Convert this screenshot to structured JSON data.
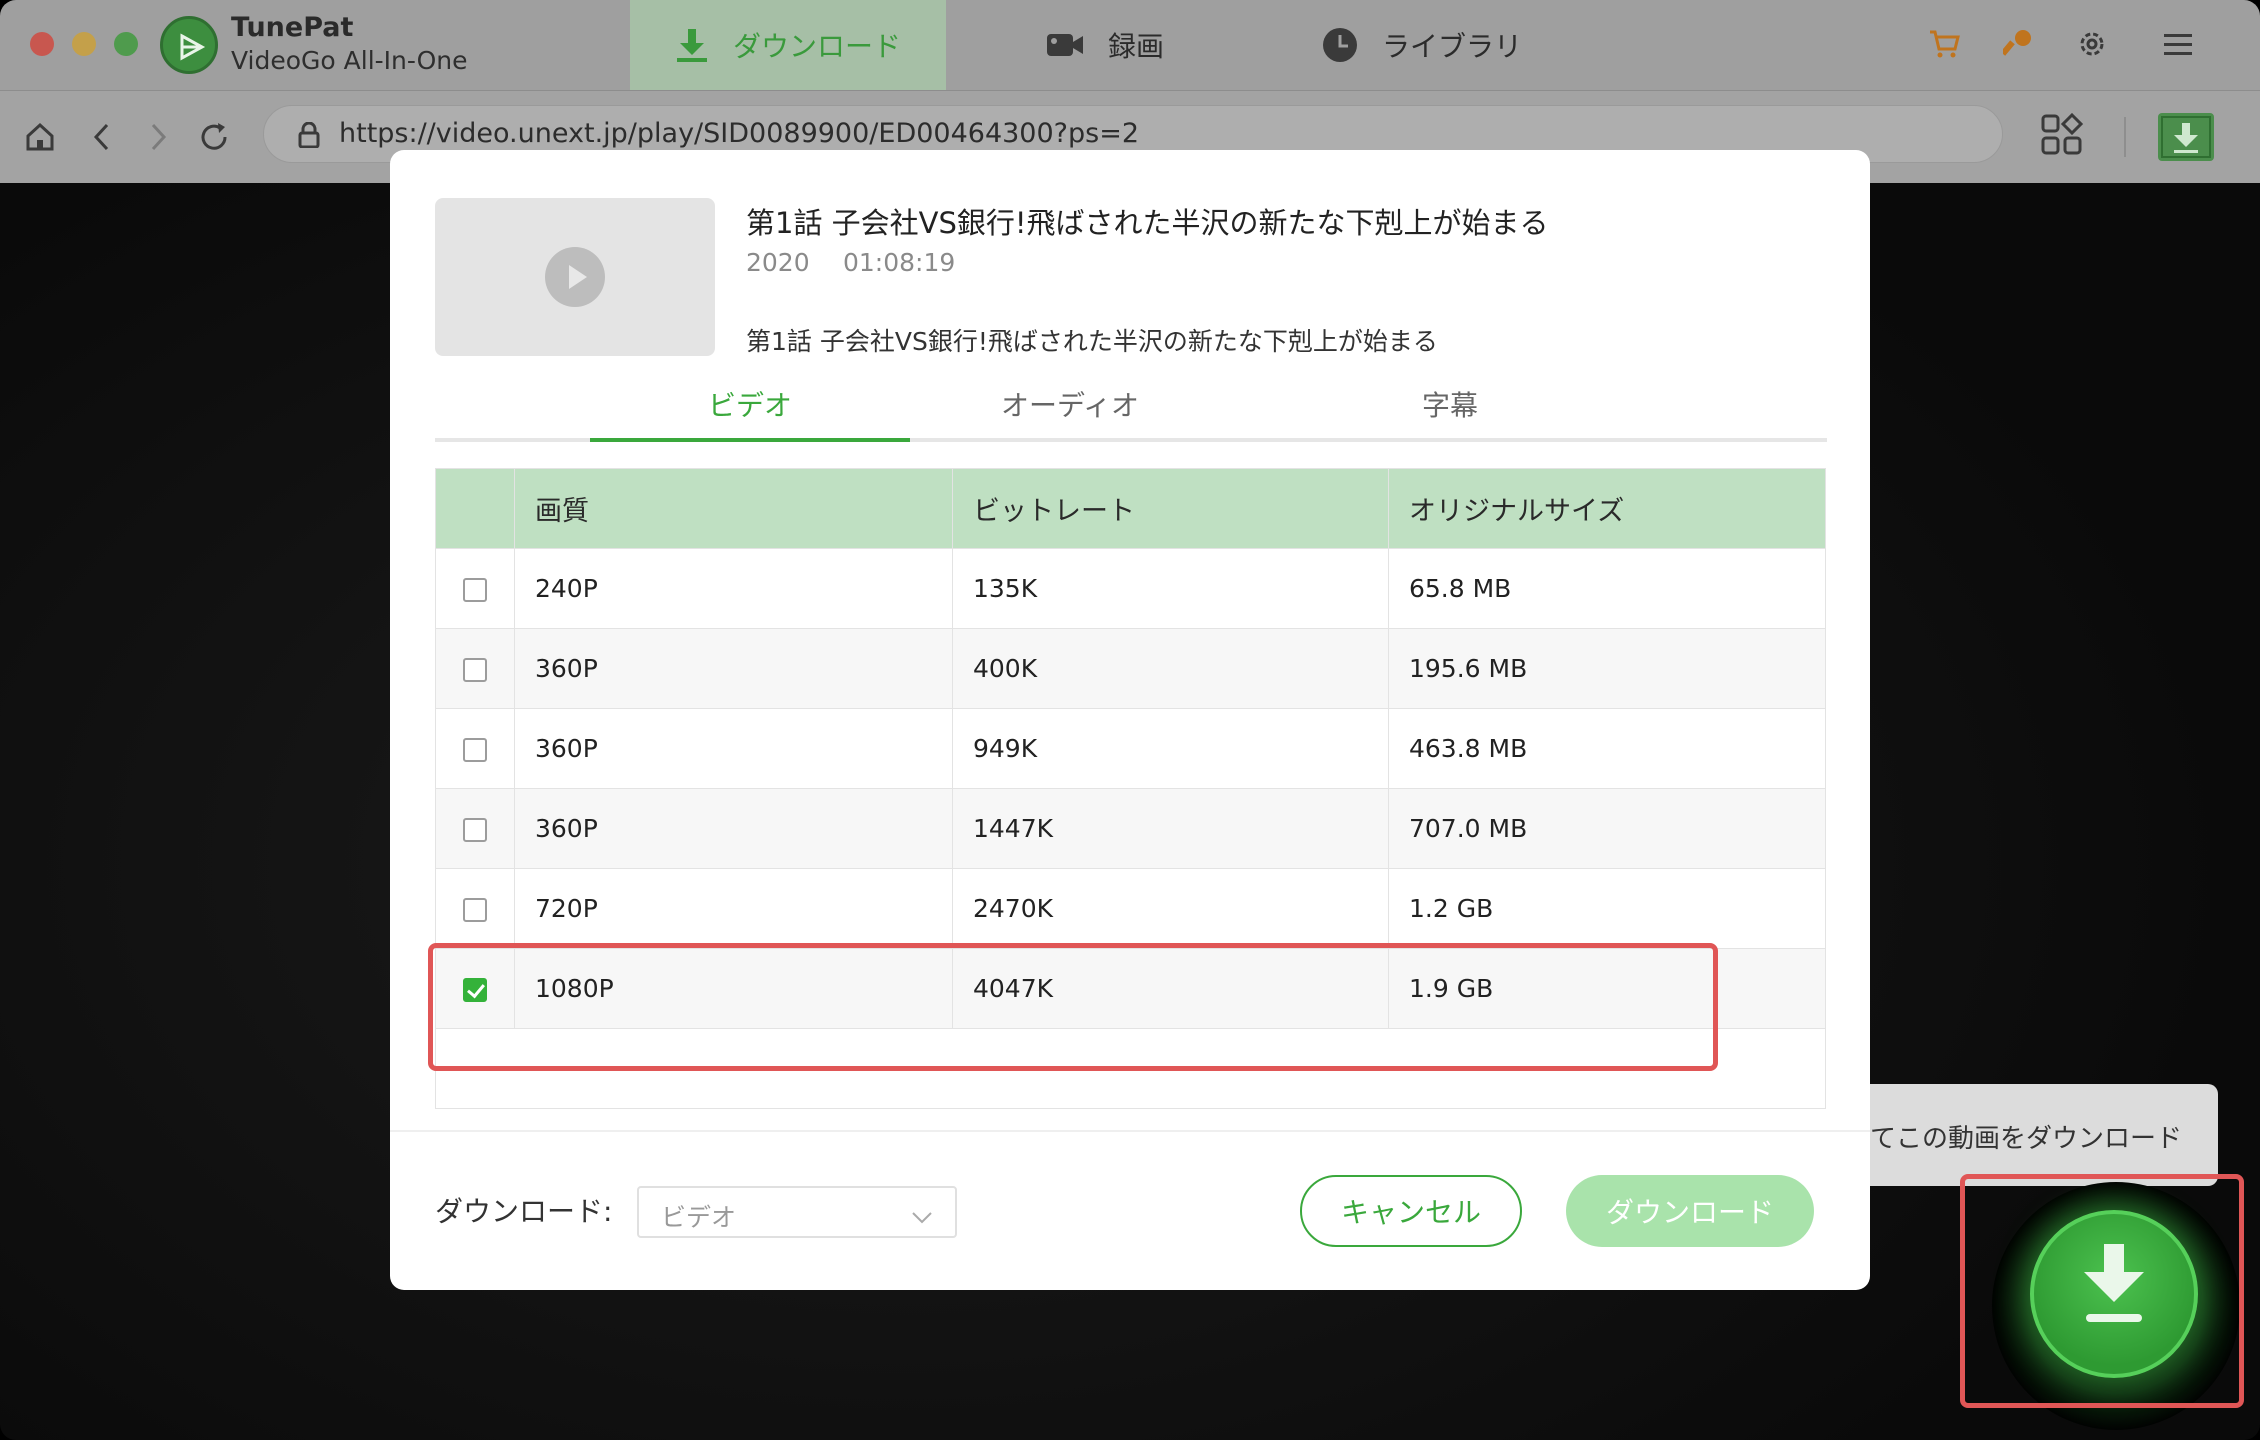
{
  "app": {
    "brand_name": "TunePat",
    "brand_subtitle": "VideoGo All-In-One"
  },
  "top_tabs": {
    "download": "ダウンロード",
    "record": "録画",
    "library": "ライブラリ"
  },
  "toolbar_icons": [
    "cart-icon",
    "key-icon",
    "gear-icon",
    "menu-icon"
  ],
  "address_bar": {
    "url": "https://video.unext.jp/play/SID0089900/ED00464300?ps=2"
  },
  "dialog": {
    "video_title": "第1話 子会社VS銀行!飛ばされた半沢の新たな下剋上が始まる",
    "year": "2020",
    "duration": "01:08:19",
    "description": "第1話 子会社VS銀行!飛ばされた半沢の新たな下剋上が始まる",
    "tabs": [
      "ビデオ",
      "オーディオ",
      "字幕"
    ],
    "active_tab": "ビデオ",
    "table": {
      "headers": [
        "画質",
        "ビットレート",
        "オリジナルサイズ"
      ],
      "rows": [
        {
          "quality": "240P",
          "bitrate": "135K",
          "size": "65.8 MB",
          "checked": false
        },
        {
          "quality": "360P",
          "bitrate": "400K",
          "size": "195.6 MB",
          "checked": false
        },
        {
          "quality": "360P",
          "bitrate": "949K",
          "size": "463.8 MB",
          "checked": false
        },
        {
          "quality": "360P",
          "bitrate": "1447K",
          "size": "707.0 MB",
          "checked": false
        },
        {
          "quality": "720P",
          "bitrate": "2470K",
          "size": "1.2 GB",
          "checked": false
        },
        {
          "quality": "1080P",
          "bitrate": "4047K",
          "size": "1.9 GB",
          "checked": true
        }
      ]
    },
    "download_label": "ダウンロード:",
    "download_select_value": "ビデオ",
    "cancel_button": "キャンセル",
    "download_button": "ダウンロード"
  },
  "tooltip": {
    "text": "てこの動画をダウンロード"
  },
  "colors": {
    "accent": "#3aa83c",
    "highlight": "#e05656",
    "table_header": "#bfe0c2"
  }
}
